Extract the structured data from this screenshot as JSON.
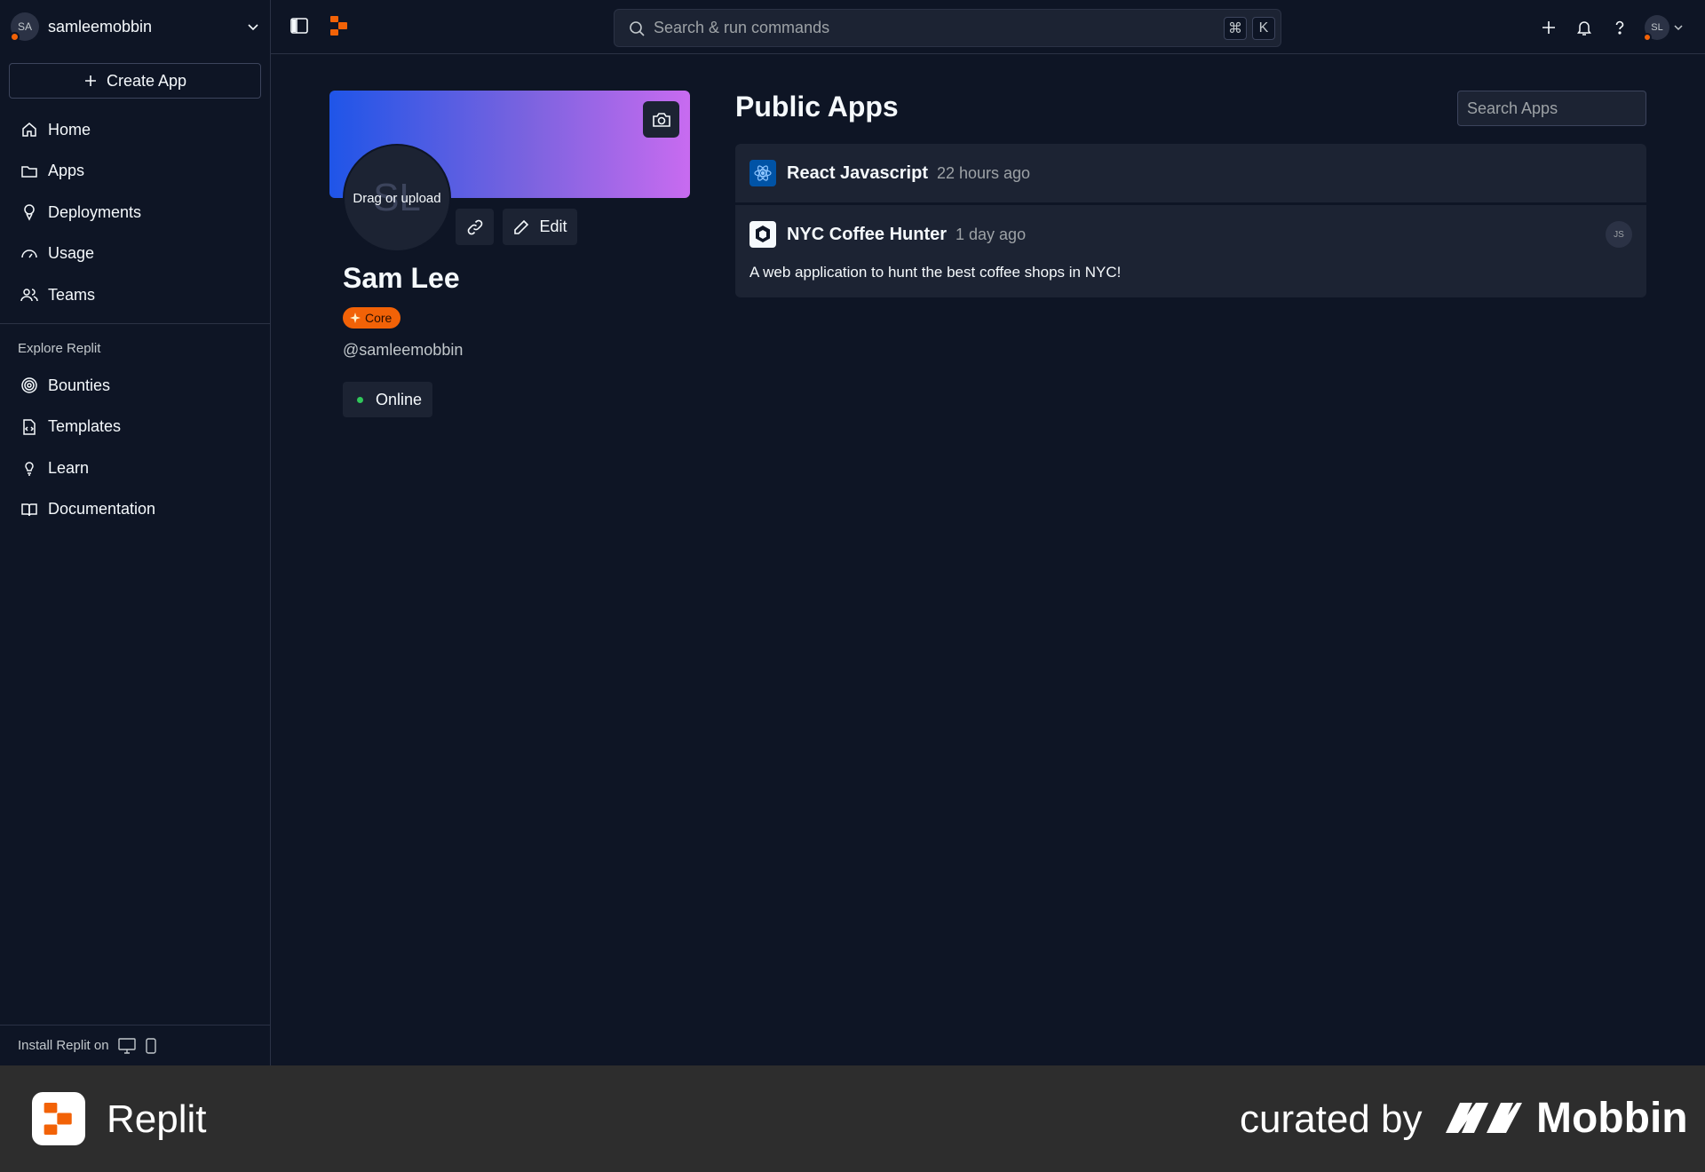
{
  "account": {
    "initials": "SA",
    "username": "samleemobbin"
  },
  "sidebar": {
    "create_label": "Create App",
    "items": [
      {
        "label": "Home",
        "icon": "home-icon"
      },
      {
        "label": "Apps",
        "icon": "folder-icon"
      },
      {
        "label": "Deployments",
        "icon": "deploy-icon"
      },
      {
        "label": "Usage",
        "icon": "gauge-icon"
      },
      {
        "label": "Teams",
        "icon": "users-icon"
      }
    ],
    "explore_label": "Explore Replit",
    "explore_items": [
      {
        "label": "Bounties",
        "icon": "bounty-icon"
      },
      {
        "label": "Templates",
        "icon": "template-icon"
      },
      {
        "label": "Learn",
        "icon": "lightbulb-icon"
      },
      {
        "label": "Documentation",
        "icon": "book-icon"
      }
    ],
    "install_label": "Install Replit on"
  },
  "topbar": {
    "search_label": "Search & run commands",
    "shortcut_cmd": "⌘",
    "shortcut_key": "K",
    "user_initials": "SL"
  },
  "profile": {
    "avatar_initials": "SL",
    "avatar_hint": "Drag or upload",
    "edit_label": "Edit",
    "name": "Sam Lee",
    "badge": "Core",
    "handle": "@samleemobbin",
    "status": "Online"
  },
  "apps": {
    "title": "Public Apps",
    "search_placeholder": "Search Apps",
    "list": [
      {
        "name": "React Javascript",
        "time": "22 hours ago",
        "description": "",
        "icon": "react-icon"
      },
      {
        "name": "NYC Coffee Hunter",
        "time": "1 day ago",
        "description": "A web application to hunt the best coffee shops in NYC!",
        "icon": "nodejs-icon",
        "lang": "JS"
      }
    ]
  },
  "footer": {
    "brand": "Replit",
    "curated": "curated by",
    "mobbin": "Mobbin"
  },
  "colors": {
    "background": "#0e1525",
    "surface": "#1c2333",
    "border": "#2b3245",
    "accent": "#f26207",
    "online": "#30c75a",
    "banner_start": "#1f55e8",
    "banner_end": "#c86bf0"
  }
}
